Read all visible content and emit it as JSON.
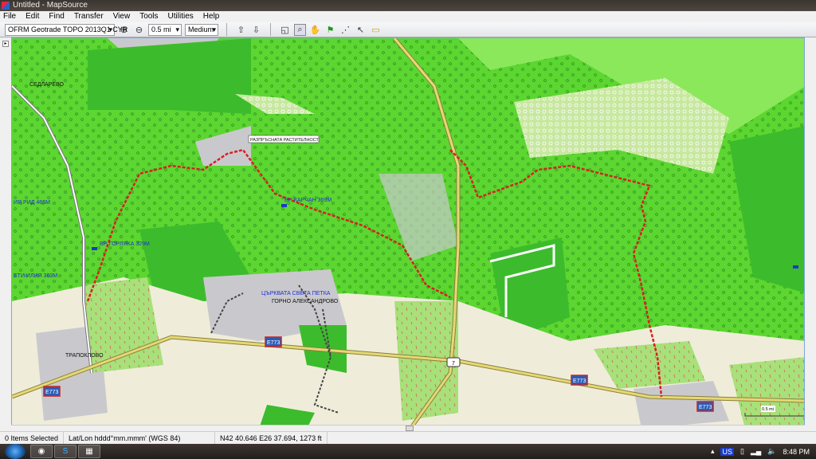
{
  "window": {
    "title": "Untitled - MapSource"
  },
  "menu": [
    "File",
    "Edit",
    "Find",
    "Transfer",
    "View",
    "Tools",
    "Utilities",
    "Help"
  ],
  "toolbar": {
    "map_product": "OFRM Geotrade TOPO 2013Q1 CYR",
    "zoom_scale": "0.5 mi",
    "detail": "Medium",
    "icons": [
      "zoom-in-icon",
      "zoom-out-icon",
      "receive-from-device-icon",
      "send-to-device-icon",
      "map-tool-icon",
      "zoom-tool-icon",
      "hand-tool-icon",
      "waypoint-tool-icon",
      "route-tool-icon",
      "selection-tool-icon",
      "measure-distance-icon"
    ]
  },
  "map": {
    "labels": {
      "sedlarevo": "СЕДЛАРЕВО",
      "rid": "ИЯ РИД 465М",
      "gorlyaka": "ВР. ГОРЛЯКА 329М",
      "iliya": "ЕТИ ИЛИЯ 363М",
      "scattered": "РАЗПРЪСНАТА РАСТИТЕЛНОСТ",
      "karchan": "ВР. КАРЧАН 369М",
      "church": "ЦЪРКВАТА СВЕТА ПЕТКА",
      "gorno": "ГОРНО АЛЕКСАНДРОВО",
      "trapoklovo": "ТРАПОКЛОВО"
    },
    "road_shields": [
      "E773",
      "E773",
      "E773",
      "E773"
    ],
    "road_number": "7",
    "scale_bar": "0.5 mi",
    "colors": {
      "forest": "#5cd630",
      "dense_forest": "#3cbc2c",
      "settlement": "#c9c9cd",
      "open": "#efedda",
      "road": "#e6d873",
      "track": "#d82020"
    }
  },
  "status": {
    "selection": "0 Items Selected",
    "format": "Lat/Lon hddd°mm.mmm' (WGS 84)",
    "position": "N42 40.646 E26 37.694, 1273 ft"
  },
  "taskbar": {
    "apps": [
      "chrome",
      "skype",
      "mapsource"
    ],
    "language": "US",
    "time": "8:48 PM"
  }
}
